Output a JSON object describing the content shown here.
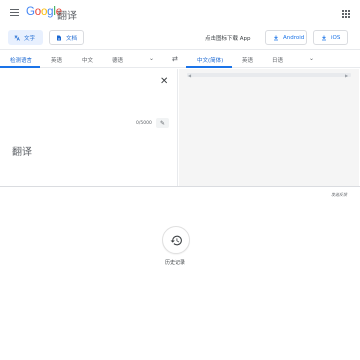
{
  "header": {
    "logo_letters": [
      "G",
      "o",
      "o",
      "g",
      "l",
      "e"
    ],
    "product_name": "翻译",
    "menu_icon": "hamburger-icon",
    "apps_icon": "apps-grid-icon"
  },
  "modes": [
    {
      "label": "文字",
      "icon": "translate-icon",
      "active": true
    },
    {
      "label": "文档",
      "icon": "document-icon",
      "active": false
    }
  ],
  "promo": {
    "text": "点击图标下载 App",
    "android_label": "Android",
    "ios_label": "iOS"
  },
  "source_languages": [
    {
      "label": "检测语言",
      "active": true
    },
    {
      "label": "英语",
      "active": false
    },
    {
      "label": "中文",
      "active": false
    },
    {
      "label": "德语",
      "active": false
    }
  ],
  "target_languages": [
    {
      "label": "中文(简体)",
      "active": true
    },
    {
      "label": "英语",
      "active": false
    },
    {
      "label": "日语",
      "active": false
    }
  ],
  "source": {
    "placeholder": "翻译",
    "char_count": "0/5000"
  },
  "footer": {
    "feedback": "发送反馈",
    "history_label": "历史记录"
  },
  "colors": {
    "accent": "#1a73e8",
    "accent_text": "#1967d2",
    "active_chip_bg": "#e8f0fe",
    "target_bg": "#f5f5f5"
  }
}
